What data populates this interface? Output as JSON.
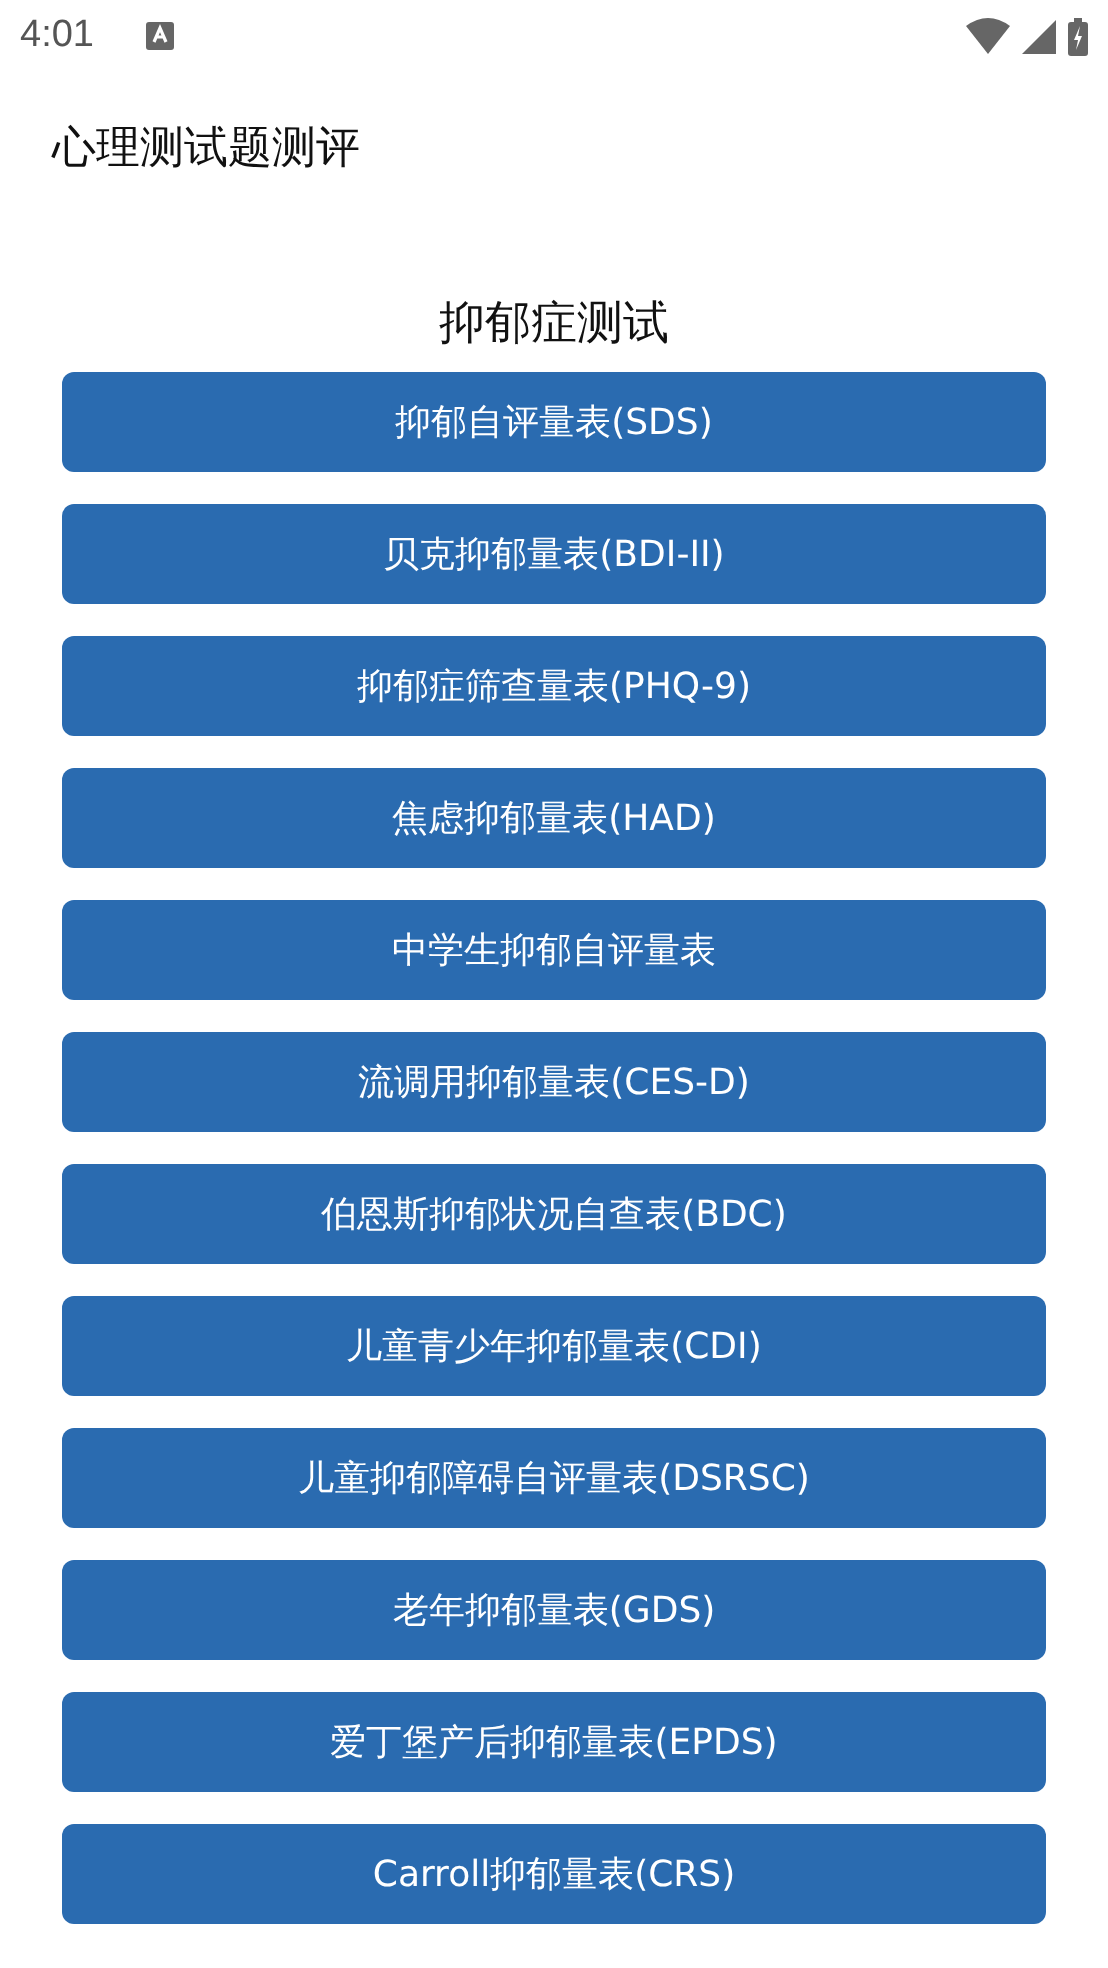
{
  "status_bar": {
    "time": "4:01"
  },
  "app_bar": {
    "title": "心理测试题测评"
  },
  "section": {
    "title": "抑郁症测试"
  },
  "buttons": [
    "抑郁自评量表(SDS)",
    "贝克抑郁量表(BDI-II)",
    "抑郁症筛查量表(PHQ-9)",
    "焦虑抑郁量表(HAD)",
    "中学生抑郁自评量表",
    "流调用抑郁量表(CES-D)",
    "伯恩斯抑郁状况自查表(BDC)",
    "儿童青少年抑郁量表(CDI)",
    "儿童抑郁障碍自评量表(DSRSC)",
    "老年抑郁量表(GDS)",
    "爱丁堡产后抑郁量表(EPDS)",
    "Carroll抑郁量表(CRS)"
  ]
}
